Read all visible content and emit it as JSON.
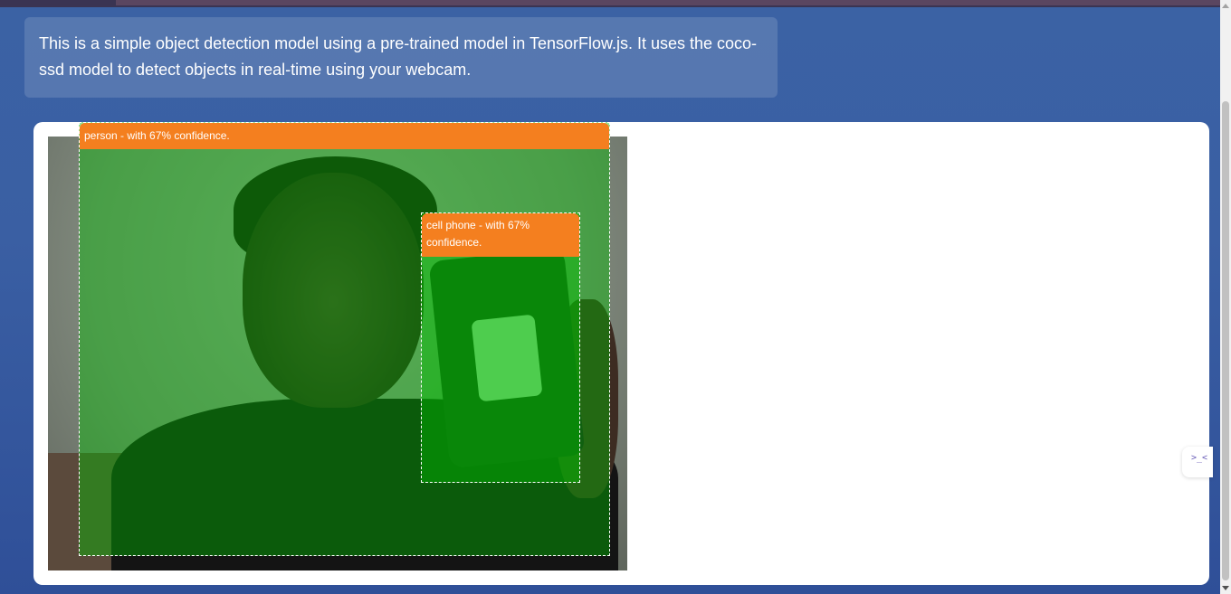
{
  "intro": {
    "text": "This is a simple object detection model using a pre-trained model in TensorFlow.js. It uses the coco-ssd model to detect objects in real-time using your webcam."
  },
  "detections": [
    {
      "class": "person",
      "label": "person - with 67% confidence.",
      "confidence": 0.67
    },
    {
      "class": "cell phone",
      "label": "cell phone - with 67% confidence.",
      "confidence": 0.67
    }
  ],
  "colors": {
    "background": "#3a5fa3",
    "label_bg": "#f47f1f",
    "highlight": "#00be00",
    "panel": "#ffffff"
  },
  "side_widget": {
    "icon": "collapse-code-icon",
    "glyph": ">_<"
  }
}
